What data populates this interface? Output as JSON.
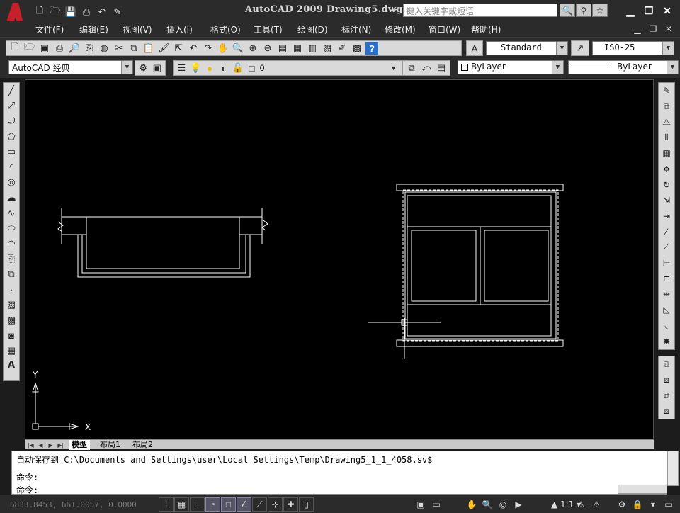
{
  "window": {
    "title": "AutoCAD 2009 Drawing5.dwg",
    "search_placeholder": "键入关键字或短语"
  },
  "menu": [
    "文件(F)",
    "编辑(E)",
    "视图(V)",
    "插入(I)",
    "格式(O)",
    "工具(T)",
    "绘图(D)",
    "标注(N)",
    "修改(M)",
    "窗口(W)",
    "帮助(H)"
  ],
  "toolbar": {
    "text_style": "Standard",
    "dim_style": "ISO-25",
    "workspace": "AutoCAD 经典",
    "layer": "0",
    "color": "ByLayer",
    "linetype": "ByLayer"
  },
  "axis": {
    "x": "X",
    "y": "Y"
  },
  "layout_tabs": [
    "模型",
    "布局1",
    "布局2"
  ],
  "command": {
    "history": "自动保存到 C:\\Documents and Settings\\user\\Local Settings\\Temp\\Drawing5_1_1_4058.sv$",
    "prompt1": "命令:",
    "prompt2": "命令:"
  },
  "status": {
    "coords": "6833.8453, 661.0057, 0.0000",
    "scale": "1:1"
  },
  "colors": {
    "canvas": "#000000",
    "chrome": "#2b2b2b",
    "logo_red": "#c8202a"
  }
}
